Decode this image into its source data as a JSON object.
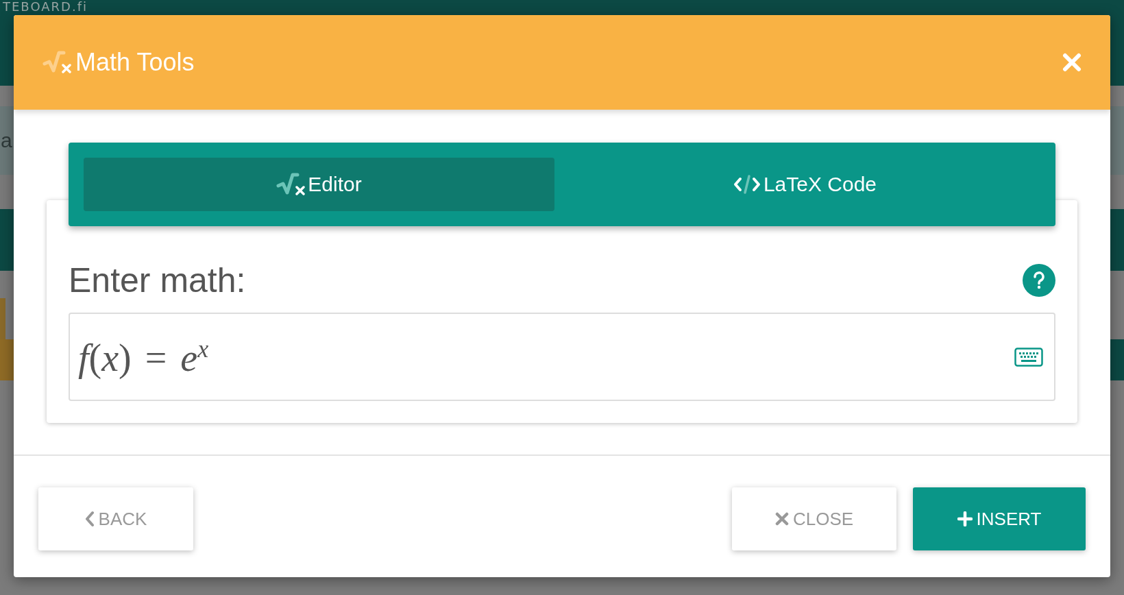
{
  "background": {
    "logo": "TEBOARD.fi",
    "fragment": "a"
  },
  "dialog": {
    "title": "Math Tools",
    "tabs": [
      {
        "label": "Editor",
        "kind": "editor",
        "selected": true
      },
      {
        "label": "LaTeX Code",
        "kind": "code",
        "selected": false
      }
    ],
    "prompt": "Enter math:",
    "math": "*f*(*x*) = *e*$^{x}$",
    "buttons": [
      {
        "label": "BACK",
        "kind": "back"
      },
      {
        "label": "CLOSE",
        "kind": "close"
      },
      {
        "label": "INSERT",
        "kind": "insert"
      }
    ]
  }
}
